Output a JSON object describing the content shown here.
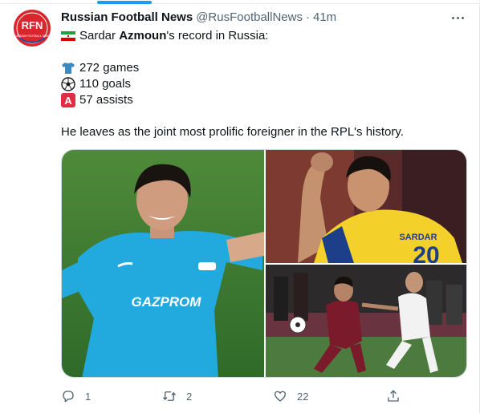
{
  "tweet": {
    "display_name": "Russian Football News",
    "handle": "@RusFootballNews",
    "separator": "·",
    "time": "41m",
    "avatar_text": "RFN",
    "lines": {
      "intro_pre": "Sardar ",
      "intro_bold": "Azmoun",
      "intro_post": "'s record in Russia:",
      "games": "272 games",
      "goals": "110 goals",
      "assists": "57 assists",
      "assists_badge": "A",
      "closing": "He leaves as the joint most prolific foreigner in the RPL's history."
    },
    "flag_icon": "iran-flag-icon",
    "stats_icons": [
      "shirt-icon",
      "soccer-ball-icon",
      "letter-a-icon"
    ],
    "photos": [
      {
        "name": "photo-zenit-celebration",
        "kit_color": "#1fa3d8",
        "sponsor": "GAZPROM"
      },
      {
        "name": "photo-yellow-kit-celebration",
        "kit_color": "#f3d12a",
        "shirt_name": "SARDAR",
        "shirt_number": "20"
      },
      {
        "name": "photo-rubin-match",
        "kit_color": "#7a1a2b"
      }
    ],
    "counts": {
      "replies": "1",
      "retweets": "2",
      "likes": "22"
    }
  },
  "colors": {
    "accent": "#1d9bf0",
    "text": "#0f1419",
    "secondary": "#536471",
    "avatar_red": "#d9262c"
  }
}
